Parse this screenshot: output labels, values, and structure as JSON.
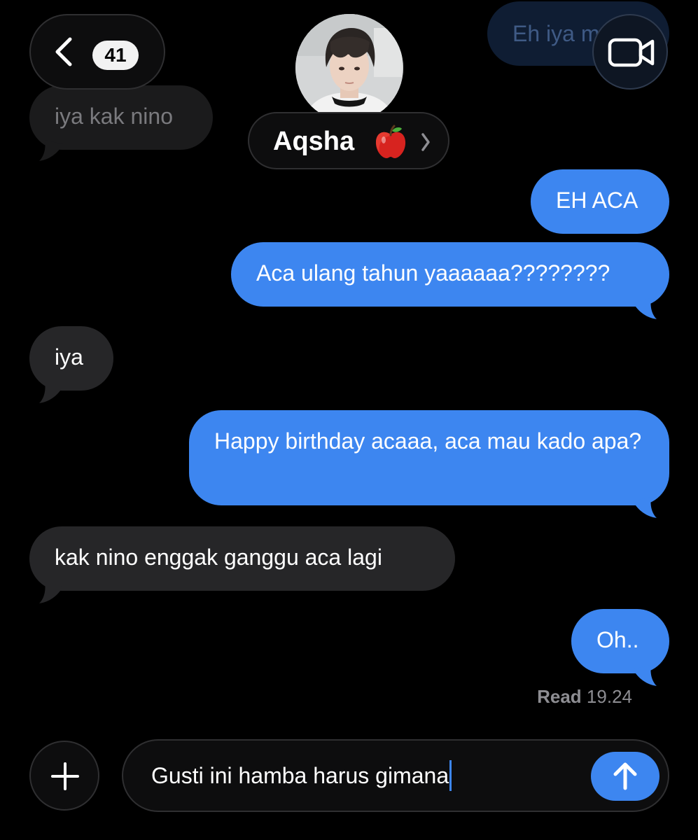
{
  "header": {
    "back_count": "41",
    "contact_name": "Aqsha",
    "name_emoji": "apple-icon",
    "video_icon": "video-camera-icon"
  },
  "messages": [
    {
      "id": "m0",
      "direction": "outgoing",
      "text": "Eh iya m",
      "faded": true
    },
    {
      "id": "m1",
      "direction": "incoming",
      "text": "iya kak nino",
      "faded": true
    },
    {
      "id": "m2",
      "direction": "outgoing",
      "text": "EH ACA"
    },
    {
      "id": "m3",
      "direction": "outgoing",
      "text": "Aca ulang tahun yaaaaaa????????"
    },
    {
      "id": "m4",
      "direction": "incoming",
      "text": "iya"
    },
    {
      "id": "m5",
      "direction": "outgoing",
      "text": "Happy birthday acaaa, aca mau kado apa?"
    },
    {
      "id": "m6",
      "direction": "incoming",
      "text": "kak nino enggak ganggu aca lagi"
    },
    {
      "id": "m7",
      "direction": "outgoing",
      "text": "Oh.."
    }
  ],
  "read_receipt": {
    "label": "Read",
    "time": "19.24"
  },
  "composer": {
    "text": "Gusti ini hamba harus gimana",
    "plus_icon": "plus-icon",
    "send_icon": "arrow-up-icon"
  },
  "colors": {
    "outgoing_bubble": "#3d86f0",
    "incoming_bubble": "#262628",
    "background": "#000000"
  }
}
